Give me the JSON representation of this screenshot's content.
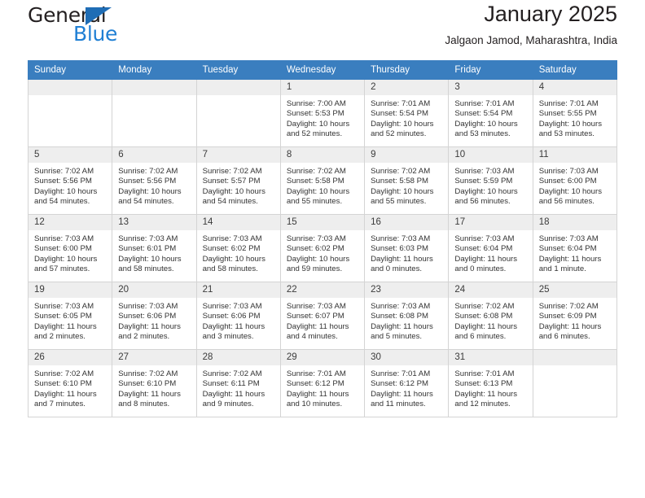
{
  "brand": {
    "name_part1": "General",
    "name_part2": "Blue",
    "logo_icon": "triangle-logo-icon"
  },
  "header": {
    "title": "January 2025",
    "subtitle": "Jalgaon Jamod, Maharashtra, India"
  },
  "calendar": {
    "weekdays": [
      "Sunday",
      "Monday",
      "Tuesday",
      "Wednesday",
      "Thursday",
      "Friday",
      "Saturday"
    ],
    "labels": {
      "sunrise": "Sunrise:",
      "sunset": "Sunset:",
      "daylight": "Daylight:"
    },
    "colors": {
      "header_bg": "#3a7ebf",
      "daynum_bg": "#eeeeee",
      "brand_blue": "#1f7fd4",
      "grid_line": "#d4d4d4"
    },
    "weeks": [
      [
        {
          "day": "",
          "empty": true
        },
        {
          "day": "",
          "empty": true
        },
        {
          "day": "",
          "empty": true
        },
        {
          "day": "1",
          "sunrise": "Sunrise: 7:00 AM",
          "sunset": "Sunset: 5:53 PM",
          "daylight1": "Daylight: 10 hours",
          "daylight2": "and 52 minutes."
        },
        {
          "day": "2",
          "sunrise": "Sunrise: 7:01 AM",
          "sunset": "Sunset: 5:54 PM",
          "daylight1": "Daylight: 10 hours",
          "daylight2": "and 52 minutes."
        },
        {
          "day": "3",
          "sunrise": "Sunrise: 7:01 AM",
          "sunset": "Sunset: 5:54 PM",
          "daylight1": "Daylight: 10 hours",
          "daylight2": "and 53 minutes."
        },
        {
          "day": "4",
          "sunrise": "Sunrise: 7:01 AM",
          "sunset": "Sunset: 5:55 PM",
          "daylight1": "Daylight: 10 hours",
          "daylight2": "and 53 minutes."
        }
      ],
      [
        {
          "day": "5",
          "sunrise": "Sunrise: 7:02 AM",
          "sunset": "Sunset: 5:56 PM",
          "daylight1": "Daylight: 10 hours",
          "daylight2": "and 54 minutes."
        },
        {
          "day": "6",
          "sunrise": "Sunrise: 7:02 AM",
          "sunset": "Sunset: 5:56 PM",
          "daylight1": "Daylight: 10 hours",
          "daylight2": "and 54 minutes."
        },
        {
          "day": "7",
          "sunrise": "Sunrise: 7:02 AM",
          "sunset": "Sunset: 5:57 PM",
          "daylight1": "Daylight: 10 hours",
          "daylight2": "and 54 minutes."
        },
        {
          "day": "8",
          "sunrise": "Sunrise: 7:02 AM",
          "sunset": "Sunset: 5:58 PM",
          "daylight1": "Daylight: 10 hours",
          "daylight2": "and 55 minutes."
        },
        {
          "day": "9",
          "sunrise": "Sunrise: 7:02 AM",
          "sunset": "Sunset: 5:58 PM",
          "daylight1": "Daylight: 10 hours",
          "daylight2": "and 55 minutes."
        },
        {
          "day": "10",
          "sunrise": "Sunrise: 7:03 AM",
          "sunset": "Sunset: 5:59 PM",
          "daylight1": "Daylight: 10 hours",
          "daylight2": "and 56 minutes."
        },
        {
          "day": "11",
          "sunrise": "Sunrise: 7:03 AM",
          "sunset": "Sunset: 6:00 PM",
          "daylight1": "Daylight: 10 hours",
          "daylight2": "and 56 minutes."
        }
      ],
      [
        {
          "day": "12",
          "sunrise": "Sunrise: 7:03 AM",
          "sunset": "Sunset: 6:00 PM",
          "daylight1": "Daylight: 10 hours",
          "daylight2": "and 57 minutes."
        },
        {
          "day": "13",
          "sunrise": "Sunrise: 7:03 AM",
          "sunset": "Sunset: 6:01 PM",
          "daylight1": "Daylight: 10 hours",
          "daylight2": "and 58 minutes."
        },
        {
          "day": "14",
          "sunrise": "Sunrise: 7:03 AM",
          "sunset": "Sunset: 6:02 PM",
          "daylight1": "Daylight: 10 hours",
          "daylight2": "and 58 minutes."
        },
        {
          "day": "15",
          "sunrise": "Sunrise: 7:03 AM",
          "sunset": "Sunset: 6:02 PM",
          "daylight1": "Daylight: 10 hours",
          "daylight2": "and 59 minutes."
        },
        {
          "day": "16",
          "sunrise": "Sunrise: 7:03 AM",
          "sunset": "Sunset: 6:03 PM",
          "daylight1": "Daylight: 11 hours",
          "daylight2": "and 0 minutes."
        },
        {
          "day": "17",
          "sunrise": "Sunrise: 7:03 AM",
          "sunset": "Sunset: 6:04 PM",
          "daylight1": "Daylight: 11 hours",
          "daylight2": "and 0 minutes."
        },
        {
          "day": "18",
          "sunrise": "Sunrise: 7:03 AM",
          "sunset": "Sunset: 6:04 PM",
          "daylight1": "Daylight: 11 hours",
          "daylight2": "and 1 minute."
        }
      ],
      [
        {
          "day": "19",
          "sunrise": "Sunrise: 7:03 AM",
          "sunset": "Sunset: 6:05 PM",
          "daylight1": "Daylight: 11 hours",
          "daylight2": "and 2 minutes."
        },
        {
          "day": "20",
          "sunrise": "Sunrise: 7:03 AM",
          "sunset": "Sunset: 6:06 PM",
          "daylight1": "Daylight: 11 hours",
          "daylight2": "and 2 minutes."
        },
        {
          "day": "21",
          "sunrise": "Sunrise: 7:03 AM",
          "sunset": "Sunset: 6:06 PM",
          "daylight1": "Daylight: 11 hours",
          "daylight2": "and 3 minutes."
        },
        {
          "day": "22",
          "sunrise": "Sunrise: 7:03 AM",
          "sunset": "Sunset: 6:07 PM",
          "daylight1": "Daylight: 11 hours",
          "daylight2": "and 4 minutes."
        },
        {
          "day": "23",
          "sunrise": "Sunrise: 7:03 AM",
          "sunset": "Sunset: 6:08 PM",
          "daylight1": "Daylight: 11 hours",
          "daylight2": "and 5 minutes."
        },
        {
          "day": "24",
          "sunrise": "Sunrise: 7:02 AM",
          "sunset": "Sunset: 6:08 PM",
          "daylight1": "Daylight: 11 hours",
          "daylight2": "and 6 minutes."
        },
        {
          "day": "25",
          "sunrise": "Sunrise: 7:02 AM",
          "sunset": "Sunset: 6:09 PM",
          "daylight1": "Daylight: 11 hours",
          "daylight2": "and 6 minutes."
        }
      ],
      [
        {
          "day": "26",
          "sunrise": "Sunrise: 7:02 AM",
          "sunset": "Sunset: 6:10 PM",
          "daylight1": "Daylight: 11 hours",
          "daylight2": "and 7 minutes."
        },
        {
          "day": "27",
          "sunrise": "Sunrise: 7:02 AM",
          "sunset": "Sunset: 6:10 PM",
          "daylight1": "Daylight: 11 hours",
          "daylight2": "and 8 minutes."
        },
        {
          "day": "28",
          "sunrise": "Sunrise: 7:02 AM",
          "sunset": "Sunset: 6:11 PM",
          "daylight1": "Daylight: 11 hours",
          "daylight2": "and 9 minutes."
        },
        {
          "day": "29",
          "sunrise": "Sunrise: 7:01 AM",
          "sunset": "Sunset: 6:12 PM",
          "daylight1": "Daylight: 11 hours",
          "daylight2": "and 10 minutes."
        },
        {
          "day": "30",
          "sunrise": "Sunrise: 7:01 AM",
          "sunset": "Sunset: 6:12 PM",
          "daylight1": "Daylight: 11 hours",
          "daylight2": "and 11 minutes."
        },
        {
          "day": "31",
          "sunrise": "Sunrise: 7:01 AM",
          "sunset": "Sunset: 6:13 PM",
          "daylight1": "Daylight: 11 hours",
          "daylight2": "and 12 minutes."
        },
        {
          "day": "",
          "empty": true
        }
      ]
    ]
  }
}
